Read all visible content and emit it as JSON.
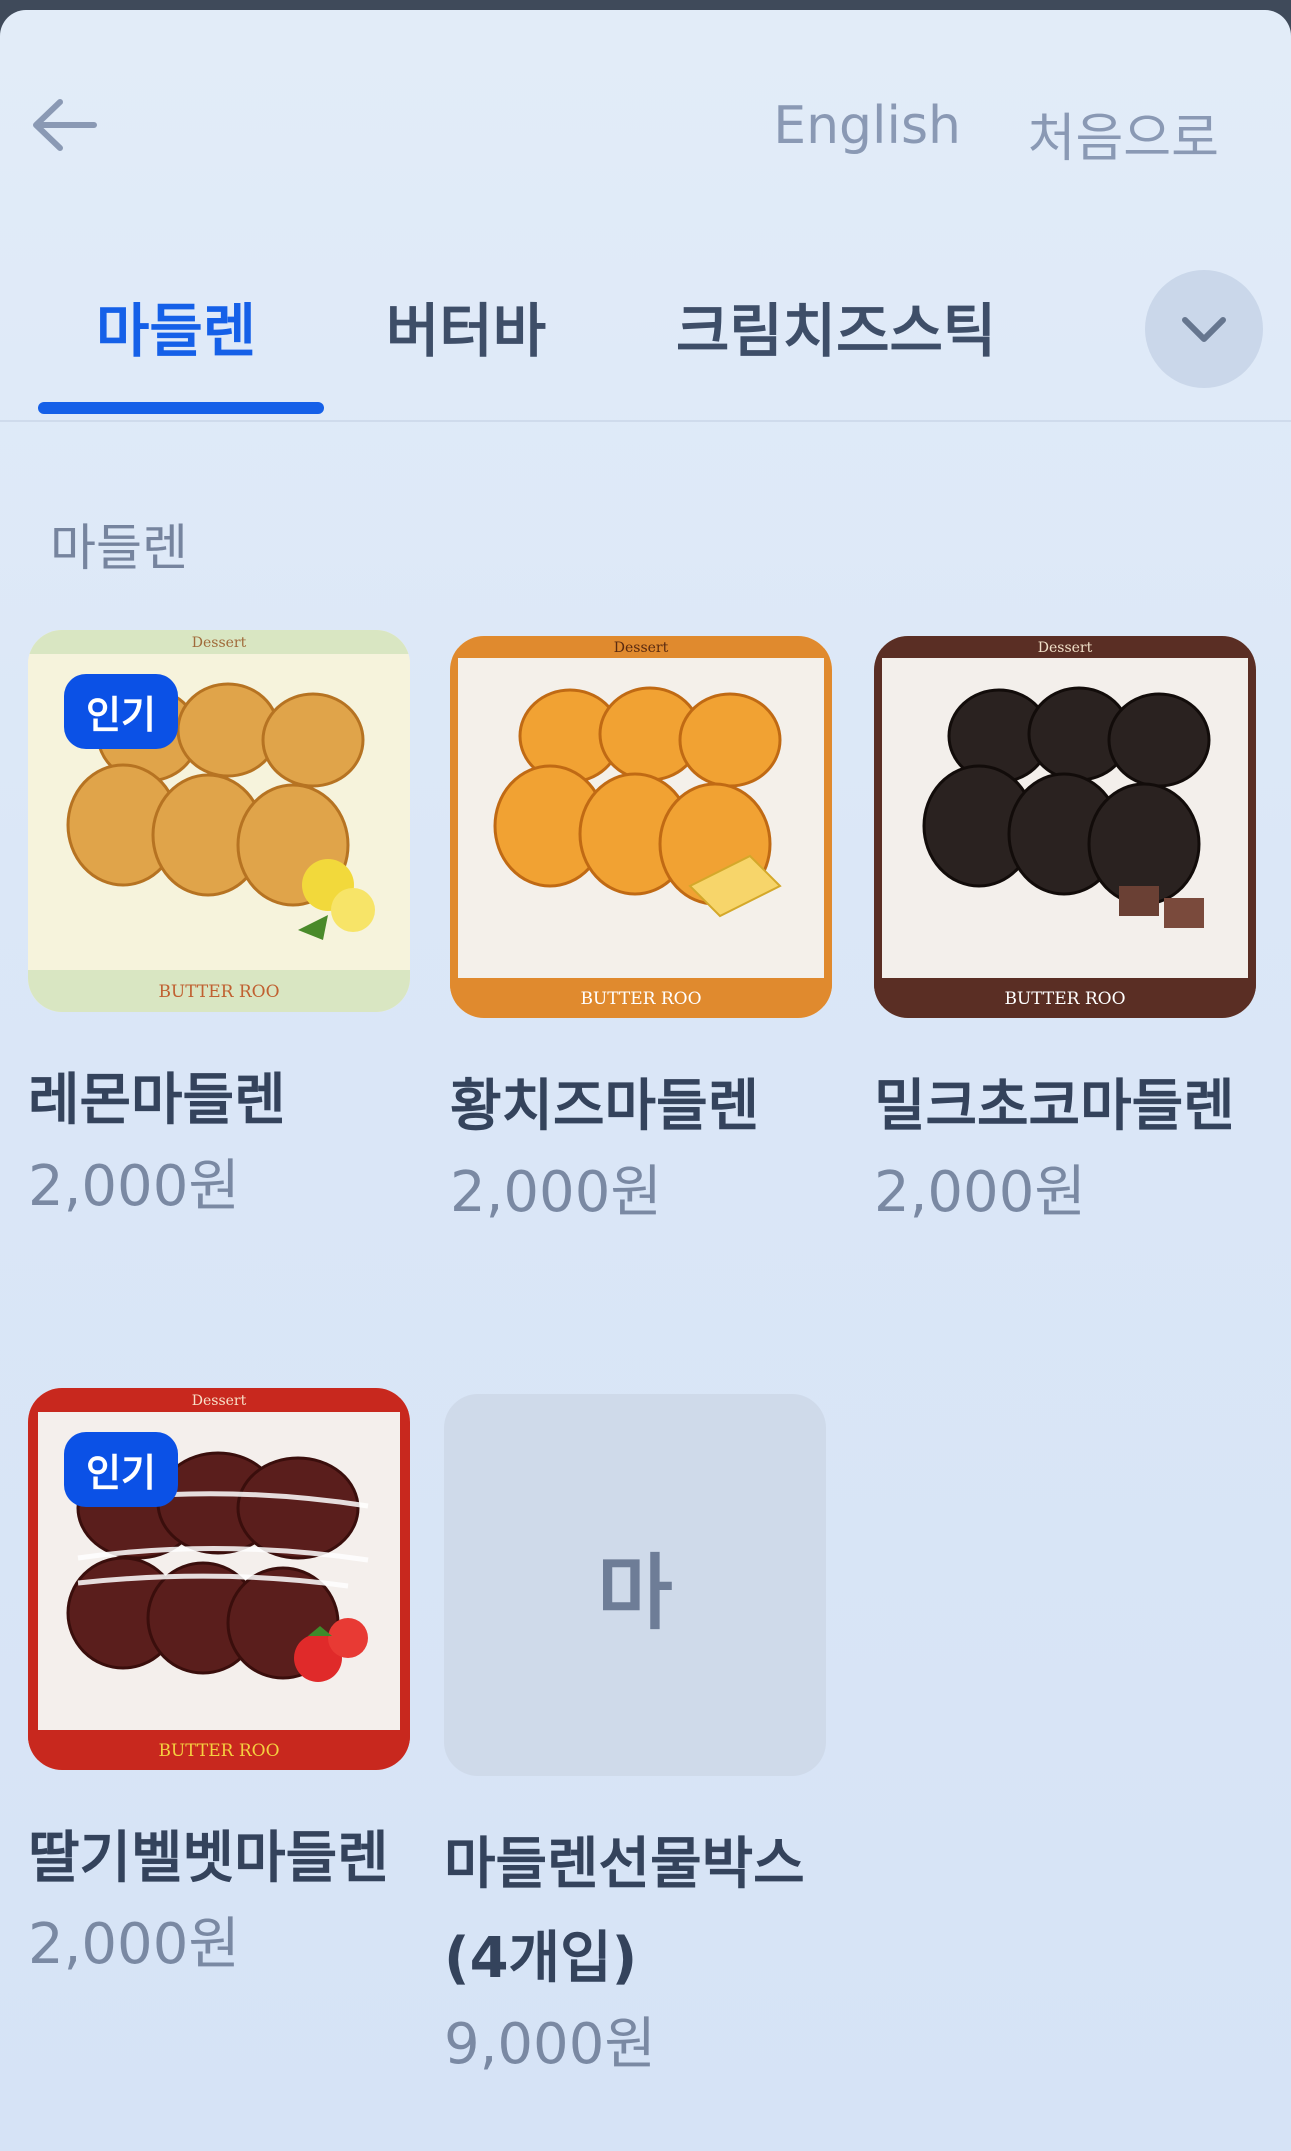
{
  "header": {
    "back_icon": "arrow-left-icon",
    "language_label": "English",
    "home_label": "처음으로"
  },
  "tabs": [
    {
      "label": "마들렌",
      "active": true
    },
    {
      "label": "버터바",
      "active": false
    },
    {
      "label": "크림치즈스틱",
      "active": false
    }
  ],
  "expand_icon": "chevron-down-icon",
  "section": {
    "title": "마들렌"
  },
  "products": [
    {
      "name": "레몬마들렌",
      "price": "2,000원",
      "badge": "인기",
      "image_header": "Dessert",
      "image_footer": "BUTTER ROO"
    },
    {
      "name": "황치즈마들렌",
      "price": "2,000원",
      "badge": "",
      "image_header": "Dessert",
      "image_footer": "BUTTER ROO"
    },
    {
      "name": "밀크초코마들렌",
      "price": "2,000원",
      "badge": "",
      "image_header": "Dessert",
      "image_footer": "BUTTER ROO"
    },
    {
      "name": "딸기벨벳마들렌",
      "price": "2,000원",
      "badge": "인기",
      "image_header": "Dessert",
      "image_footer": "BUTTER ROO"
    },
    {
      "name": "마들렌선물박스(4개입)",
      "price": "9,000원",
      "badge": "",
      "placeholder_initial": "마"
    }
  ],
  "colors": {
    "accent": "#1560e8",
    "badge": "#0b51e6"
  }
}
